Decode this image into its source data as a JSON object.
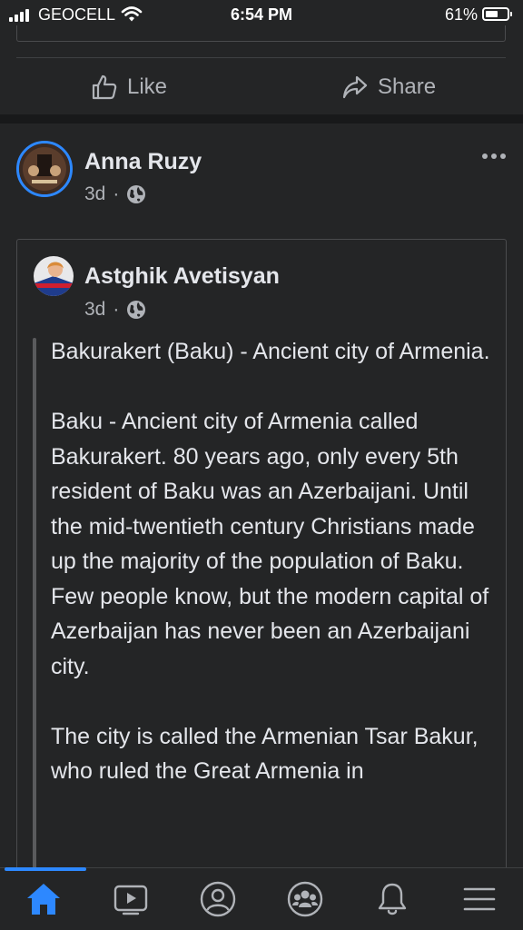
{
  "status_bar": {
    "carrier": "GEOCELL",
    "time": "6:54 PM",
    "battery_percent": "61%",
    "battery_level": 0.61
  },
  "previous_post": {
    "like_label": "Like",
    "share_label": "Share"
  },
  "post": {
    "author": "Anna Ruzy",
    "time": "3d",
    "separator": "·",
    "audience_icon": "globe-icon",
    "more_icon": "more-options-icon",
    "shared": {
      "author": "Astghik Avetisyan",
      "time": "3d",
      "separator": "·",
      "paragraphs": [
        "Bakurakert (Baku) - Ancient city of Armenia.",
        "Baku - Ancient city of Armenia called Bakurakert. 80 years ago, only every 5th resident of Baku was an Azerbaijani. Until the mid-twentieth century Christians made up the majority of the population of Baku. Few people know, but the modern capital of Azerbaijan has never been an Azerbaijani city.",
        "The city is called the Armenian Tsar Bakur, who ruled the Great Armenia in"
      ]
    }
  },
  "bottom_nav": {
    "items": [
      "home-icon",
      "watch-icon",
      "profile-icon",
      "groups-icon",
      "notifications-icon",
      "menu-icon"
    ],
    "active": "home-icon"
  },
  "colors": {
    "background": "#242526",
    "accent": "#2d88ff",
    "text_primary": "#e4e6eb",
    "text_secondary": "#b0b3b8"
  }
}
